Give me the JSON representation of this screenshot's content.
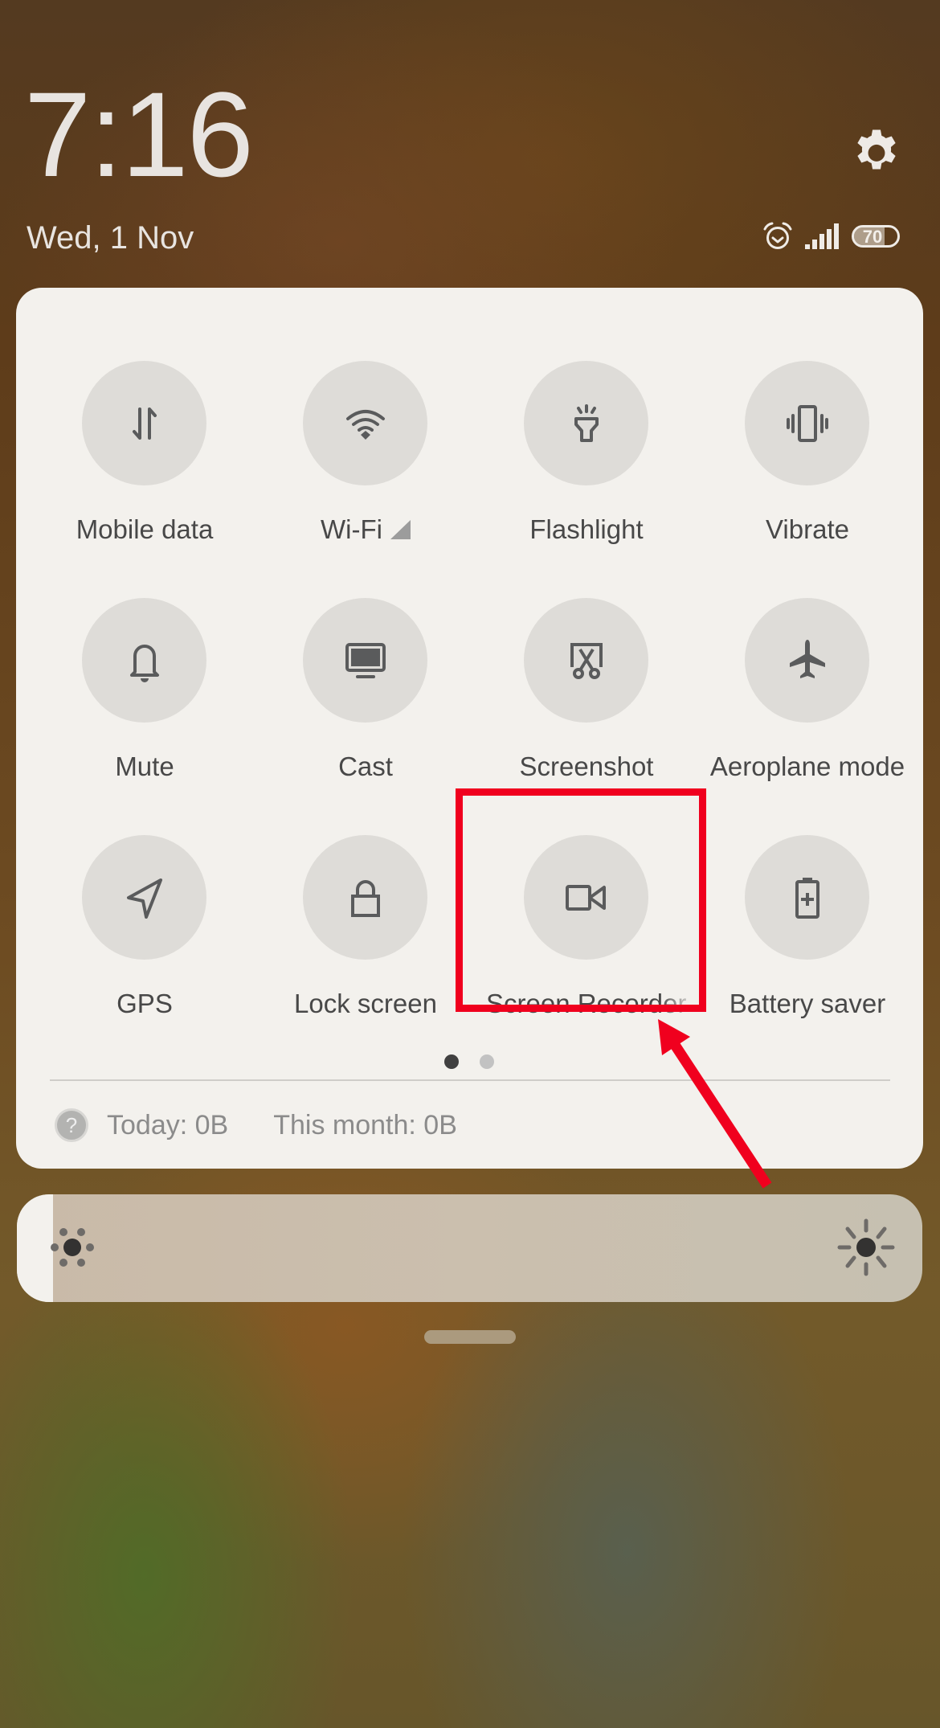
{
  "header": {
    "time": "7:16",
    "date": "Wed, 1 Nov",
    "settings_icon": "gear-icon",
    "status": {
      "alarm_icon": "alarm-icon",
      "signal_icon": "signal-icon",
      "battery_level": "70",
      "battery_fraction": 0.7
    }
  },
  "quick_settings": {
    "tiles": [
      {
        "label": "Mobile data",
        "icon": "mobile-data-icon"
      },
      {
        "label": "Wi-Fi",
        "icon": "wifi-icon"
      },
      {
        "label": "Flashlight",
        "icon": "flashlight-icon"
      },
      {
        "label": "Vibrate",
        "icon": "vibrate-icon"
      },
      {
        "label": "Mute",
        "icon": "bell-icon"
      },
      {
        "label": "Cast",
        "icon": "cast-icon"
      },
      {
        "label": "Screenshot",
        "icon": "screenshot-icon"
      },
      {
        "label": "Aeroplane mode",
        "icon": "airplane-icon"
      },
      {
        "label": "GPS",
        "icon": "gps-icon"
      },
      {
        "label": "Lock screen",
        "icon": "lock-icon"
      },
      {
        "label": "Screen Recorder",
        "icon": "video-camera-icon"
      },
      {
        "label": "Battery saver",
        "icon": "battery-saver-icon"
      }
    ],
    "pages": {
      "current": 1,
      "total": 2
    }
  },
  "data_usage": {
    "help_icon": "?",
    "today": "Today: 0B",
    "this_month": "This month: 0B"
  },
  "brightness": {
    "level_fraction": 0.04,
    "low_icon": "brightness-low-icon",
    "high_icon": "brightness-high-icon"
  },
  "annotation": {
    "highlight_color": "#f0001e",
    "highlighted_tile": "Screen Recorder"
  }
}
